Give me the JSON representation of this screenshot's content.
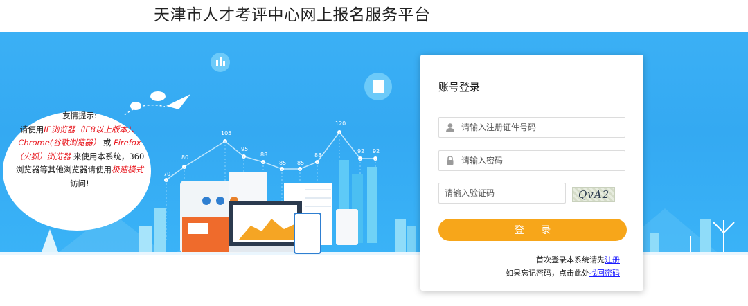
{
  "header": {
    "title": "天津市人才考评中心网上报名服务平台"
  },
  "tip": {
    "title": "友情提示:",
    "line1_a": "请使用",
    "ie": "IE浏览器（IE8以上版本）、",
    "chrome": "Chrome(谷歌浏览器）",
    "or": "或",
    "firefox": "Firefox（火狐）浏览器",
    "middle": "来使用本系统，360浏览器等其他浏览器请使用",
    "speed_mode": "极速模式",
    "end": "访问!"
  },
  "chart_labels": [
    "70",
    "80",
    "105",
    "95",
    "88",
    "85",
    "85",
    "88",
    "120",
    "92",
    "92"
  ],
  "login": {
    "title": "账号登录",
    "id_placeholder": "请输入注册证件号码",
    "password_placeholder": "请输入密码",
    "captcha_placeholder": "请输入验证码",
    "captcha_text": "QvA2",
    "submit": "登 录",
    "register_prefix": "首次登录本系统请先",
    "register_link": "注册",
    "forgot_prefix": "如果忘记密码，点击此处",
    "forgot_link": "找回密码"
  },
  "colors": {
    "banner": "#37adf4",
    "button": "#f7a61a",
    "link": "#1a1aff",
    "tip_red": "#e8141b"
  }
}
